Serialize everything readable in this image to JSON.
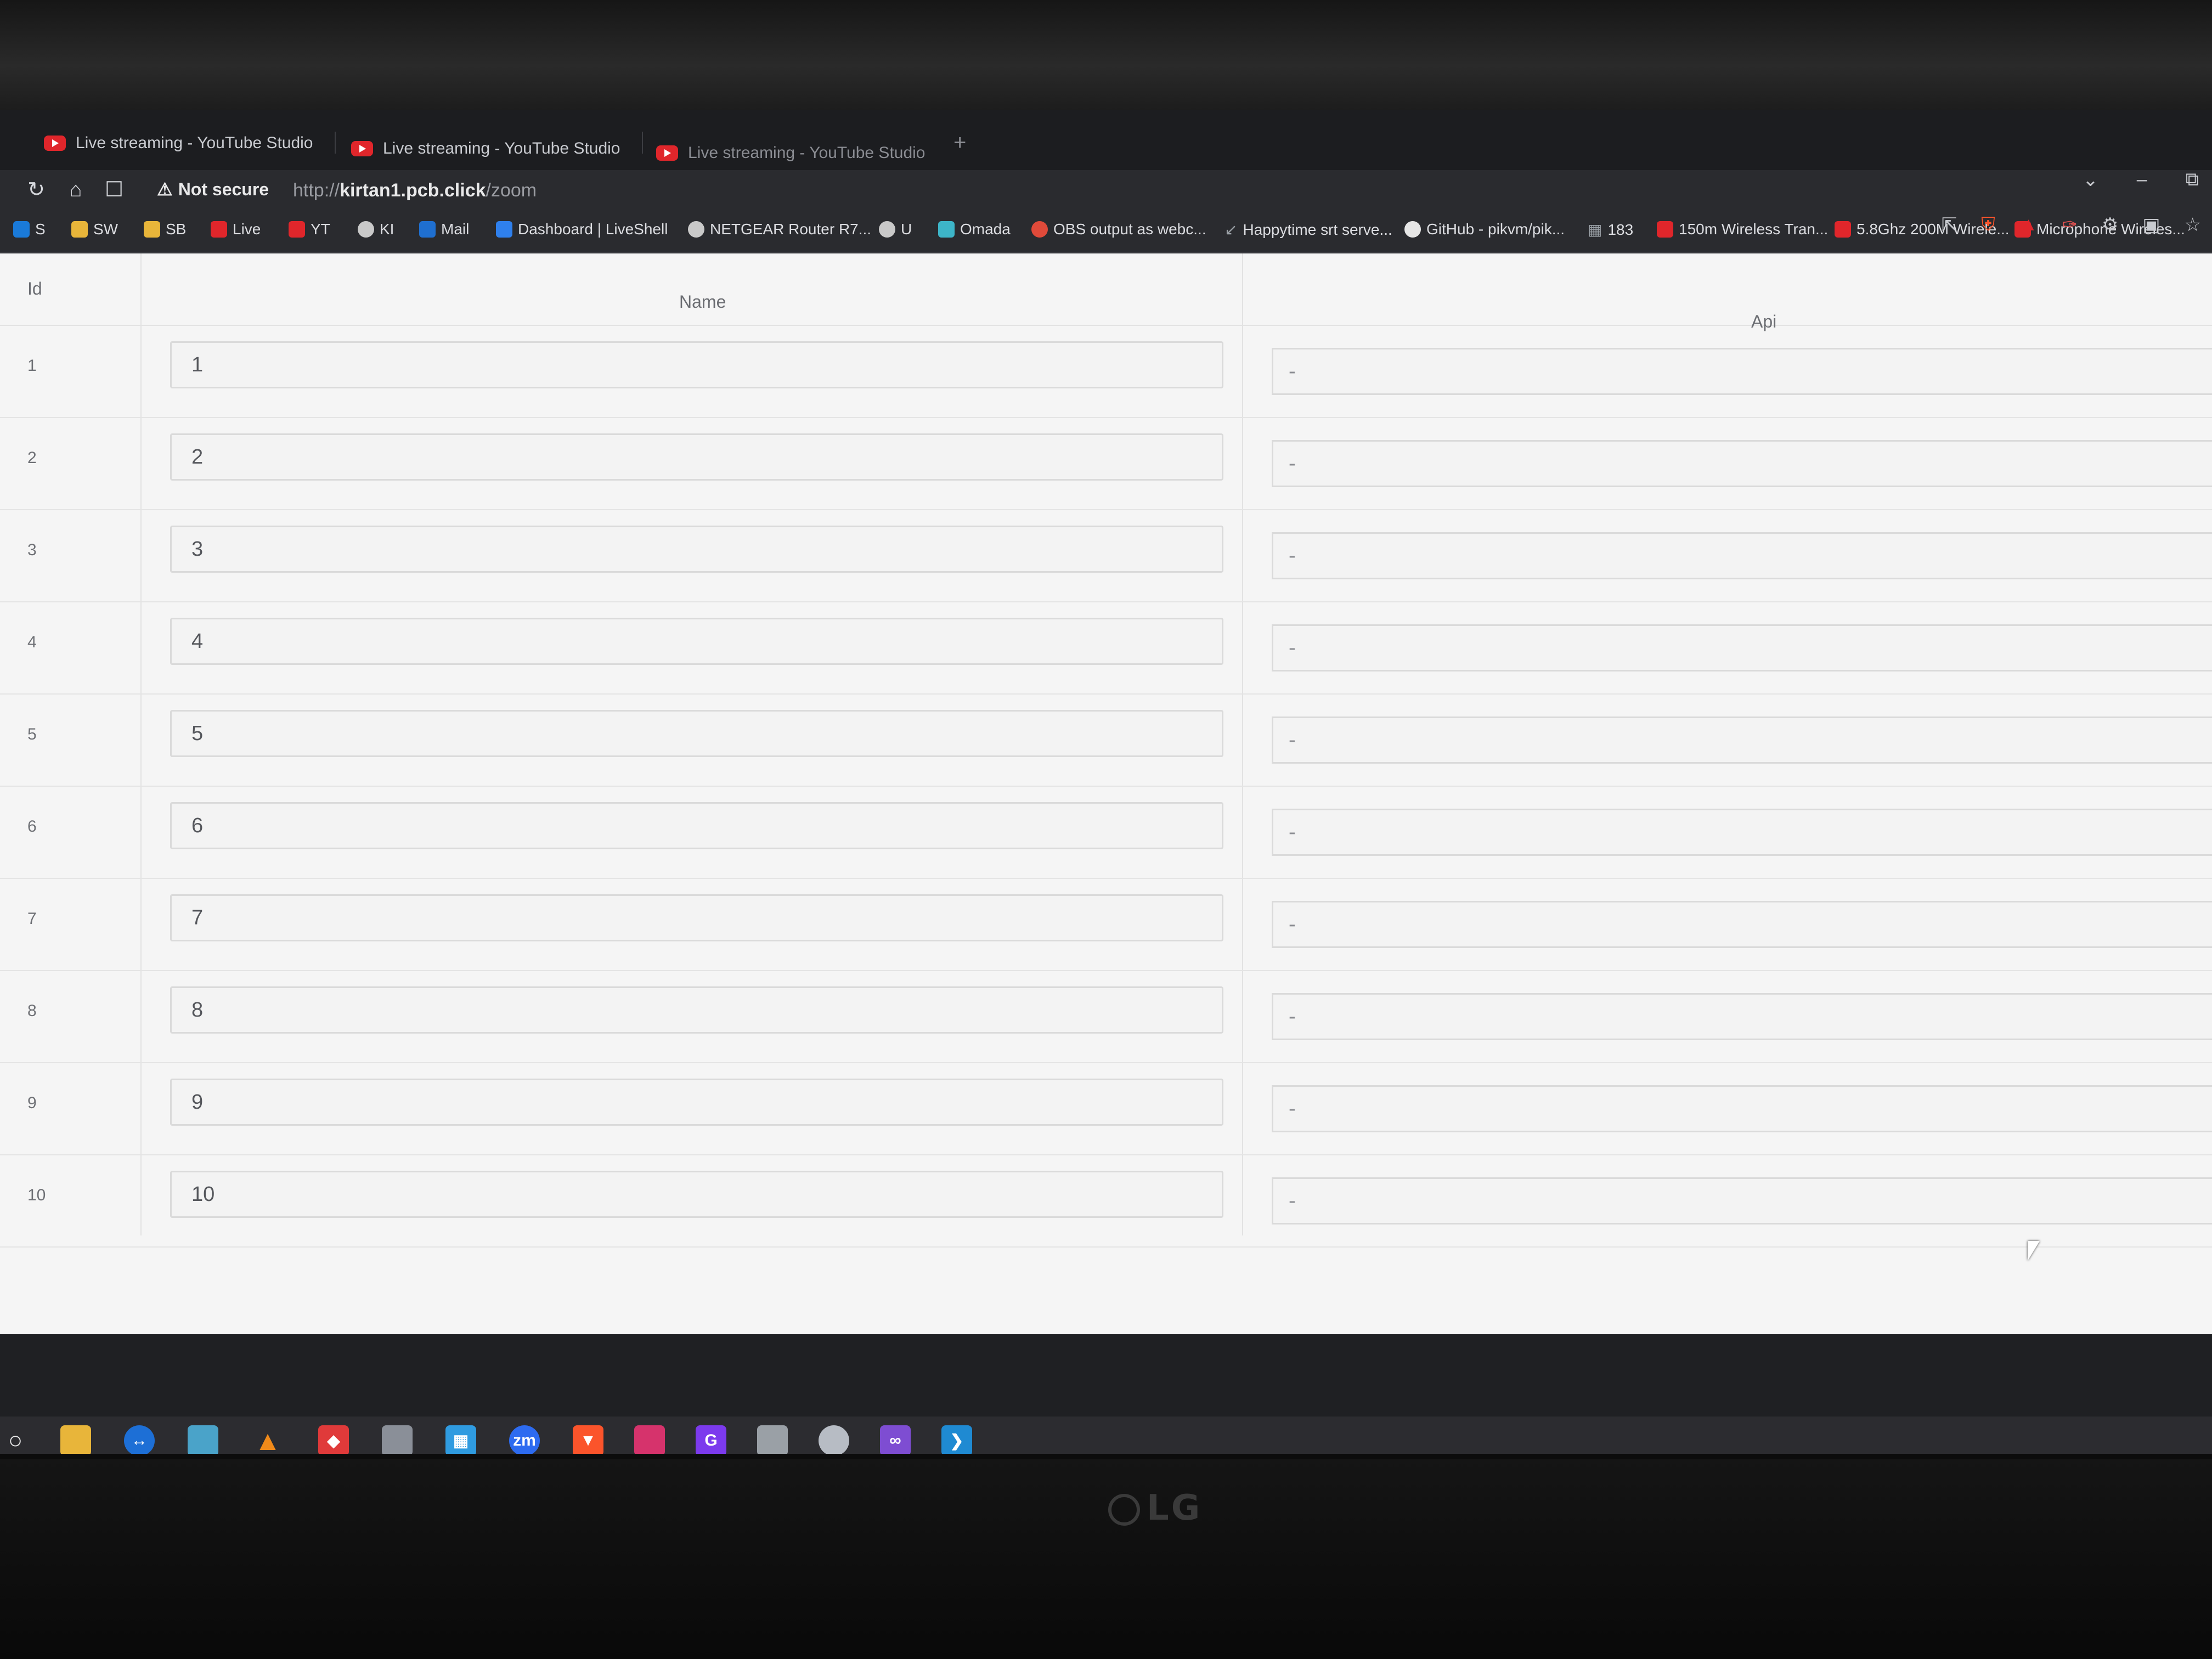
{
  "browser": {
    "tabs": [
      {
        "label": "Live streaming - YouTube Studio"
      },
      {
        "label": "Live streaming - YouTube Studio"
      },
      {
        "label": "Live streaming - YouTube Studio"
      }
    ],
    "security_label": "Not secure",
    "url": {
      "scheme": "http://",
      "host": "kirtan1.pcb.click",
      "path": "/zoom"
    },
    "bookmarks": [
      {
        "label": "S",
        "icon": "skype-icon",
        "color": "#1a7ad9"
      },
      {
        "label": "SW",
        "icon": "folder-icon",
        "color": "#e8b53a"
      },
      {
        "label": "SB",
        "icon": "folder-icon",
        "color": "#e8b53a"
      },
      {
        "label": "Live",
        "icon": "youtube-icon",
        "color": "#e0262b"
      },
      {
        "label": "YT",
        "icon": "youtube-icon",
        "color": "#e0262b"
      },
      {
        "label": "KI",
        "icon": "globe-icon",
        "color": "#c9c9c9"
      },
      {
        "label": "Mail",
        "icon": "outlook-icon",
        "color": "#1f6fd0"
      },
      {
        "label": "Dashboard | LiveShell",
        "icon": "shield-icon",
        "color": "#2f80ed"
      },
      {
        "label": "NETGEAR Router R7...",
        "icon": "globe-icon",
        "color": "#c9c9c9"
      },
      {
        "label": "U",
        "icon": "globe-icon",
        "color": "#c9c9c9"
      },
      {
        "label": "Omada",
        "icon": "omada-icon",
        "color": "#3db5c8"
      },
      {
        "label": "OBS output as webc...",
        "icon": "obs-icon",
        "color": "#e04a3a"
      },
      {
        "label": "Happytime srt serve...",
        "icon": "arrow-icon",
        "color": "#9aa0a6"
      },
      {
        "label": "GitHub - pikvm/pik...",
        "icon": "github-icon",
        "color": "#e6e6e6"
      },
      {
        "label": "183",
        "icon": "grid-icon",
        "color": "#9aa0a6"
      },
      {
        "label": "150m Wireless Tran...",
        "icon": "store-icon",
        "color": "#e0262b"
      },
      {
        "label": "5.8Ghz 200M Wirele...",
        "icon": "store-icon",
        "color": "#e0262b"
      },
      {
        "label": "Microphone Wireles...",
        "icon": "store-icon",
        "color": "#e0262b"
      }
    ]
  },
  "table": {
    "headers": {
      "id": "Id",
      "name": "Name",
      "api": "Api"
    },
    "rows": [
      {
        "id": "1",
        "name": "1",
        "api": "-"
      },
      {
        "id": "2",
        "name": "2",
        "api": "-"
      },
      {
        "id": "3",
        "name": "3",
        "api": "-"
      },
      {
        "id": "4",
        "name": "4",
        "api": "-"
      },
      {
        "id": "5",
        "name": "5",
        "api": "-"
      },
      {
        "id": "6",
        "name": "6",
        "api": "-"
      },
      {
        "id": "7",
        "name": "7",
        "api": "-"
      },
      {
        "id": "8",
        "name": "8",
        "api": "-"
      },
      {
        "id": "9",
        "name": "9",
        "api": "-"
      },
      {
        "id": "10",
        "name": "10",
        "api": "-"
      }
    ]
  },
  "taskbar": {
    "apps": [
      {
        "icon": "search-icon",
        "color": "#2c2c30"
      },
      {
        "icon": "file-explorer-icon",
        "color": "#e8b53a"
      },
      {
        "icon": "teamviewer-icon",
        "color": "#1d6fd6"
      },
      {
        "icon": "app-icon",
        "color": "#4aa3c9"
      },
      {
        "icon": "vlc-icon",
        "color": "#f08a1a"
      },
      {
        "icon": "anydesk-icon",
        "color": "#e03a3a"
      },
      {
        "icon": "app-icon",
        "color": "#8a8f98"
      },
      {
        "icon": "windows-store-icon",
        "color": "#2f9be0"
      },
      {
        "icon": "zoom-icon",
        "color": "#2d6bf0",
        "label": "zm"
      },
      {
        "icon": "brave-icon",
        "color": "#fb542b"
      },
      {
        "icon": "app-icon",
        "color": "#d6336c"
      },
      {
        "icon": "app-icon",
        "color": "#7c3aed"
      },
      {
        "icon": "app-icon",
        "color": "#9aa0a6"
      },
      {
        "icon": "app-icon",
        "color": "#b7bcc4"
      },
      {
        "icon": "visual-studio-icon",
        "color": "#7e4dd2"
      },
      {
        "icon": "vscode-icon",
        "color": "#1f8ad2"
      }
    ]
  },
  "monitor": {
    "brand": "LG"
  }
}
